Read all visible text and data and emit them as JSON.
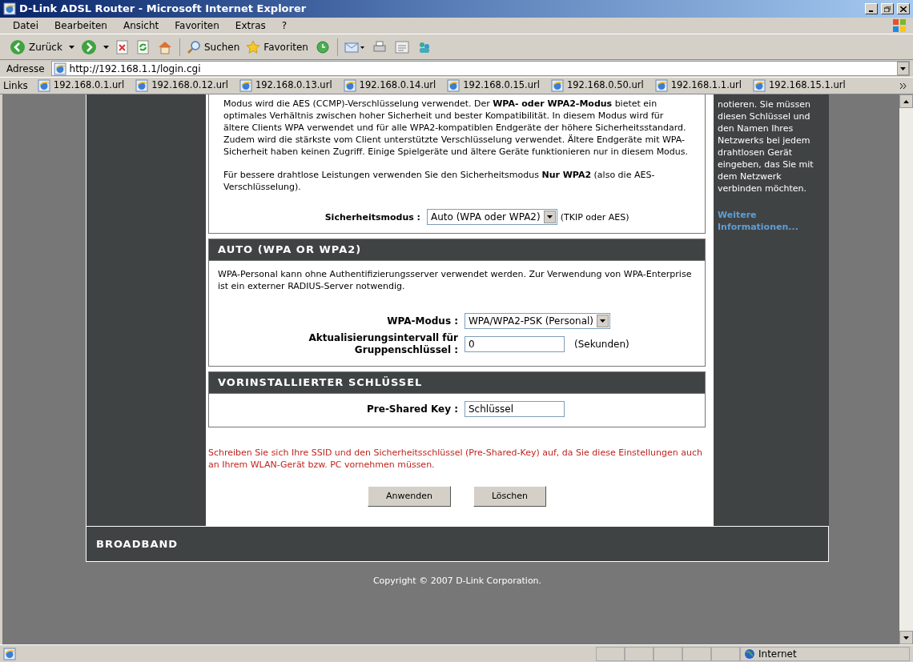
{
  "window": {
    "title": "D-Link ADSL Router - Microsoft Internet Explorer"
  },
  "menu": [
    "Datei",
    "Bearbeiten",
    "Ansicht",
    "Favoriten",
    "Extras",
    "?"
  ],
  "toolbar": {
    "back": "Zurück",
    "search": "Suchen",
    "favorites": "Favoriten"
  },
  "address": {
    "label": "Adresse",
    "url": "http://192.168.1.1/login.cgi"
  },
  "links": {
    "label": "Links",
    "items": [
      "192.168.0.1.url",
      "192.168.0.12.url",
      "192.168.0.13.url",
      "192.168.0.14.url",
      "192.168.0.15.url",
      "192.168.0.50.url",
      "192.168.1.1.url",
      "192.168.15.1.url"
    ]
  },
  "intro": {
    "paragraphs": [
      "Modus wird die AES (CCMP)-Verschlüsselung verwendet. Der **WPA- oder WPA2-Modus** bietet ein optimales Verhältnis zwischen hoher Sicherheit und bester Kompatibilität. In diesem Modus wird für ältere Clients WPA verwendet und für alle WPA2-kompatiblen Endgeräte der höhere Sicherheitsstandard. Zudem wird die stärkste vom Client unterstützte Verschlüsselung verwendet. Ältere Endgeräte mit WPA-Sicherheit haben keinen Zugriff. Einige Spielgeräte und ältere Geräte funktionieren nur in diesem Modus.",
      "Für bessere drahtlose Leistungen verwenden Sie den Sicherheitsmodus **Nur WPA2** (also die AES-Verschlüsselung)."
    ],
    "field": {
      "label": "Sicherheitsmodus :",
      "value": "Auto (WPA oder WPA2)",
      "note": "(TKIP oder AES)"
    }
  },
  "sections": [
    {
      "title": "AUTO (WPA OR WPA2)",
      "text": "WPA-Personal kann ohne Authentifizierungsserver verwendet werden. Zur Verwendung von WPA-Enterprise ist ein externer RADIUS-Server notwendig.",
      "fields": [
        {
          "kind": "select",
          "label": "WPA-Modus :",
          "value": "WPA/WPA2-PSK (Personal)"
        },
        {
          "kind": "input",
          "label": "Aktualisierungsintervall für Gruppenschlüssel :",
          "value": "0",
          "note": "(Sekunden)"
        }
      ]
    },
    {
      "title": "VORINSTALLIERTER SCHLÜSSEL",
      "fields": [
        {
          "kind": "input",
          "label": "Pre-Shared Key :",
          "value": "Schlüssel"
        }
      ]
    }
  ],
  "warning": "Schreiben Sie sich Ihre SSID und den Sicherheitsschlüssel (Pre-Shared-Key) auf, da Sie diese Einstellungen auch an Ihrem WLAN-Gerät bzw. PC vornehmen müssen.",
  "buttons": [
    "Anwenden",
    "Löschen"
  ],
  "help": {
    "text": "notieren. Sie müssen diesen Schlüssel und den Namen Ihres Netzwerks bei jedem drahtlosen Gerät eingeben, das Sie mit dem Netzwerk verbinden möchten.",
    "link": "Weitere Informationen..."
  },
  "footer": {
    "brand": "BROADBAND",
    "copyright": "Copyright © 2007 D-Link Corporation."
  },
  "status_bar": {
    "zone": "Internet"
  }
}
